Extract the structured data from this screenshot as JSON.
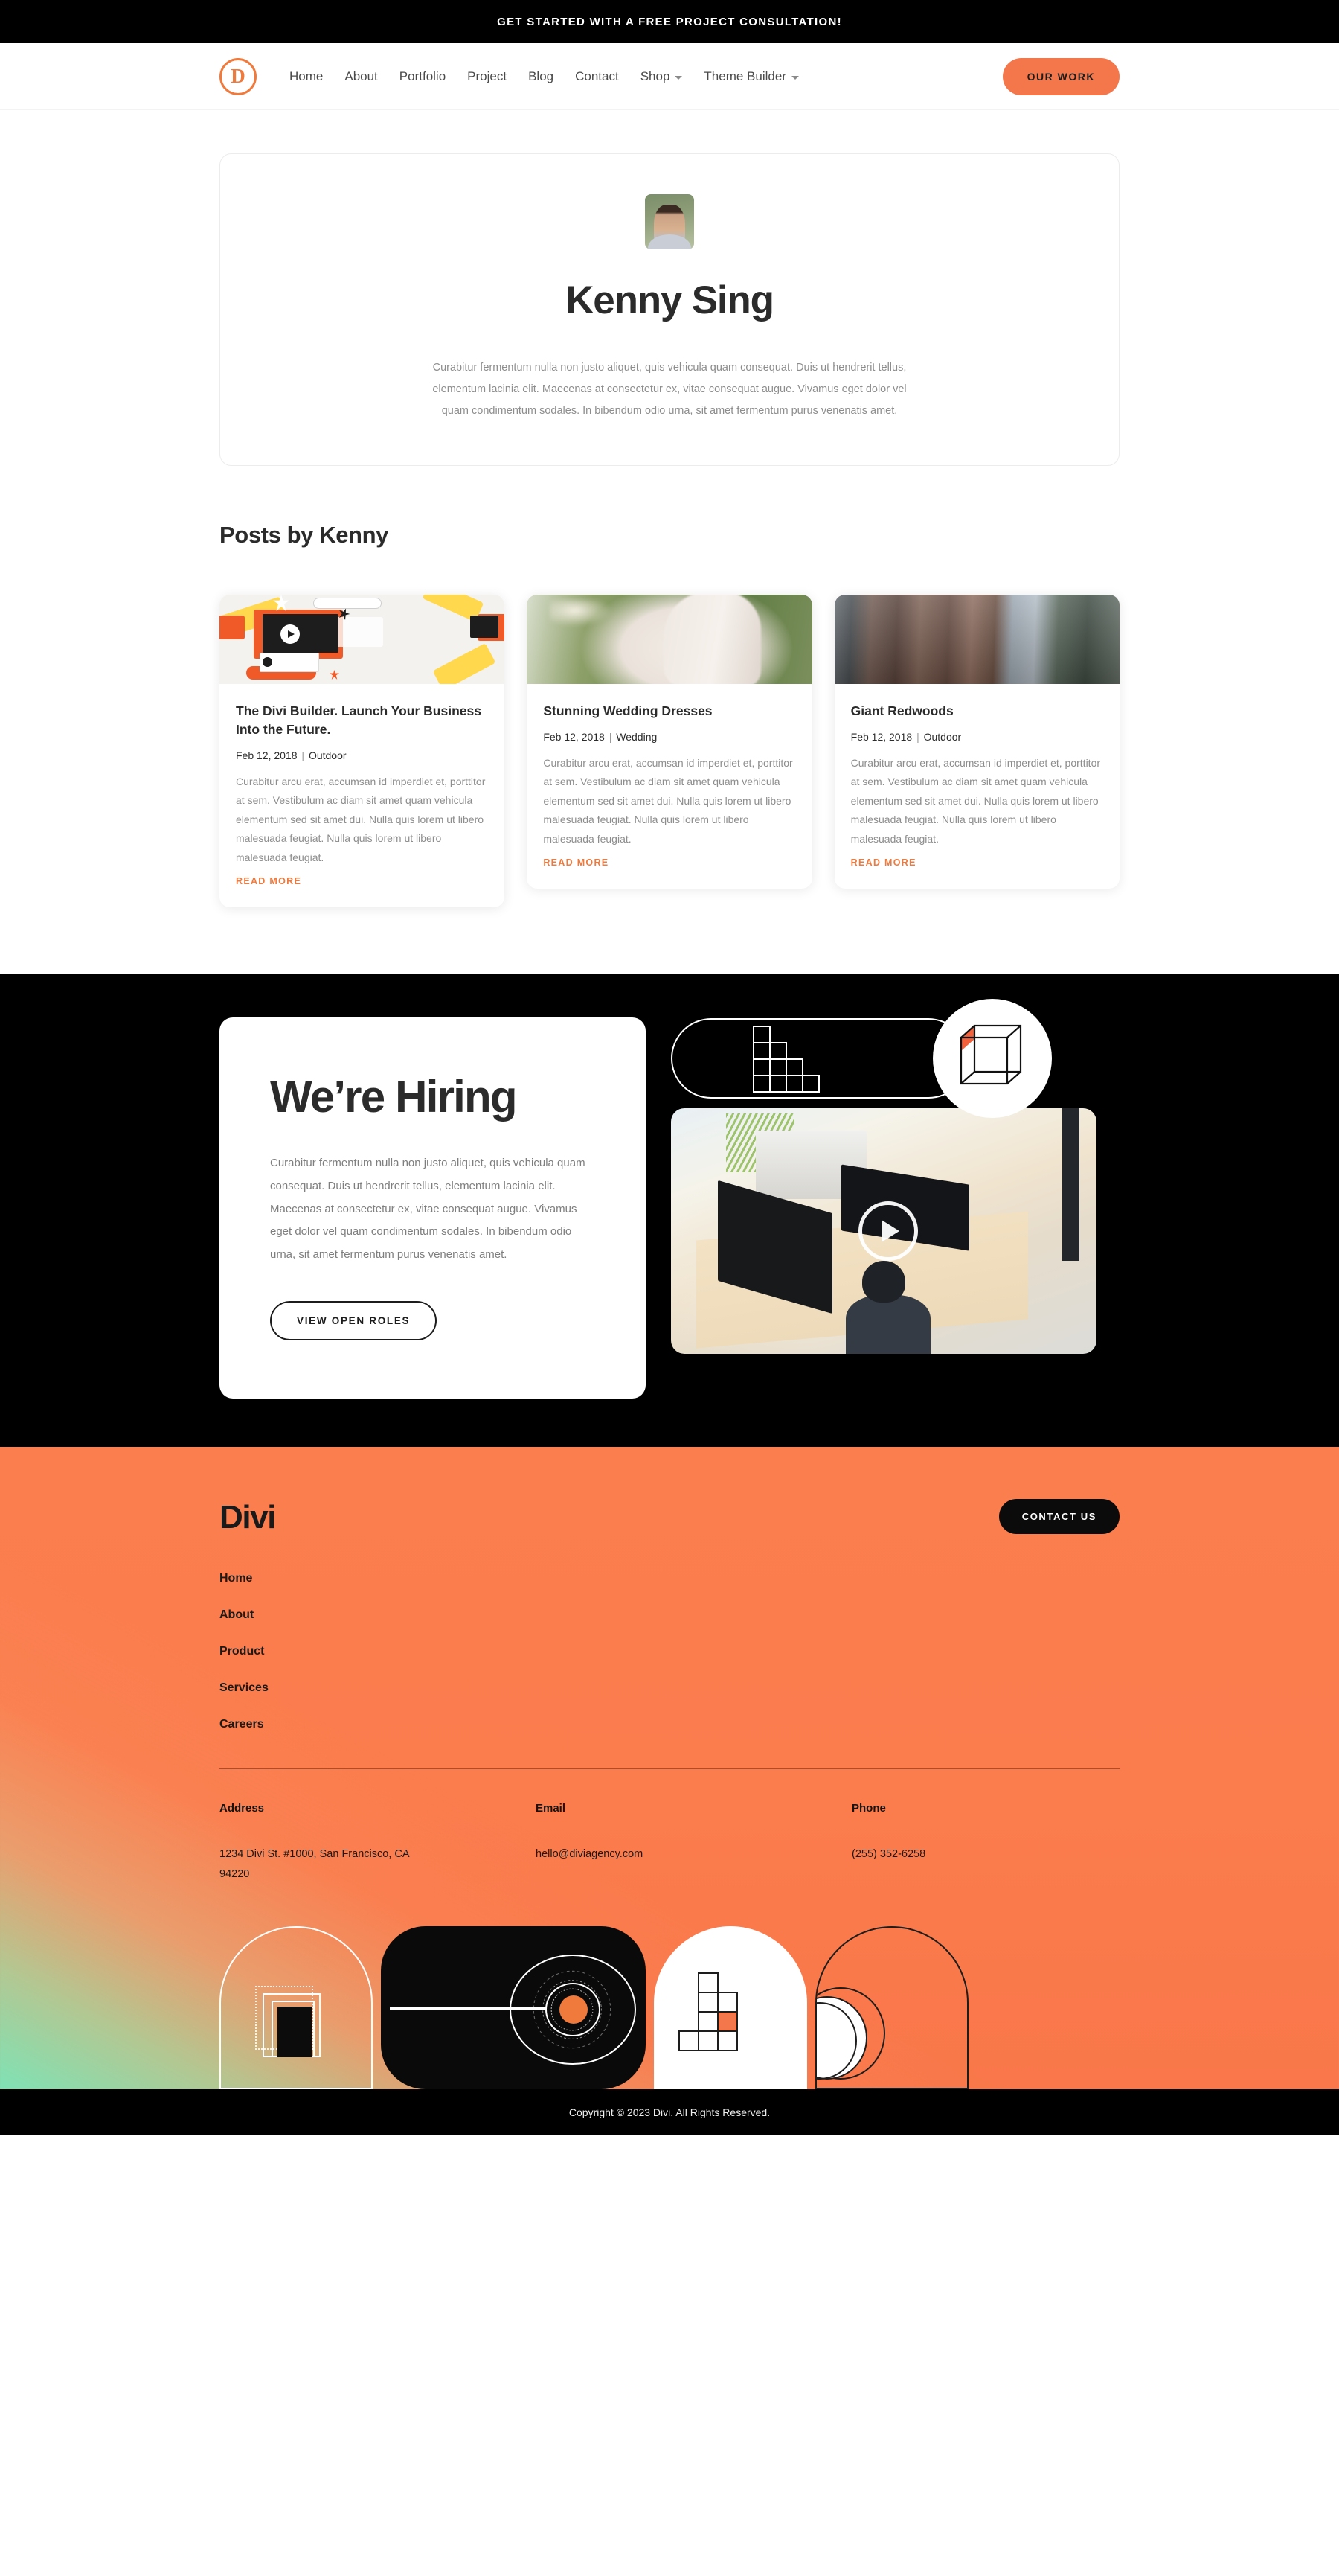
{
  "announcement": {
    "text": "GET STARTED WITH A FREE PROJECT CONSULTATION!"
  },
  "header": {
    "logo_letter": "D",
    "nav": [
      {
        "label": "Home",
        "has_caret": false
      },
      {
        "label": "About",
        "has_caret": false
      },
      {
        "label": "Portfolio",
        "has_caret": false
      },
      {
        "label": "Project",
        "has_caret": false
      },
      {
        "label": "Blog",
        "has_caret": false
      },
      {
        "label": "Contact",
        "has_caret": false
      },
      {
        "label": "Shop",
        "has_caret": true
      },
      {
        "label": "Theme Builder",
        "has_caret": true
      }
    ],
    "cta_label": "OUR WORK"
  },
  "author": {
    "name": "Kenny Sing",
    "bio": "Curabitur fermentum nulla non justo aliquet, quis vehicula quam consequat. Duis ut hendrerit tellus, elementum lacinia elit. Maecenas at consectetur ex, vitae consequat augue. Vivamus eget dolor vel quam condimentum sodales. In bibendum odio urna, sit amet fermentum purus venenatis amet."
  },
  "posts_section": {
    "title": "Posts by Kenny",
    "read_more_label": "READ MORE",
    "posts": [
      {
        "title": "The Divi Builder. Launch Your Business Into the Future.",
        "date": "Feb 12, 2018",
        "category": "Outdoor",
        "excerpt": "Curabitur arcu erat, accumsan id imperdiet et, porttitor at sem. Vestibulum ac diam sit amet quam vehicula elementum sed sit amet dui. Nulla quis lorem ut libero malesuada feugiat. Nulla quis lorem ut libero malesuada feugiat.",
        "thumb": "divi-builder-illustration"
      },
      {
        "title": "Stunning Wedding Dresses",
        "date": "Feb 12, 2018",
        "category": "Wedding",
        "excerpt": "Curabitur arcu erat, accumsan id imperdiet et, porttitor at sem. Vestibulum ac diam sit amet quam vehicula elementum sed sit amet dui. Nulla quis lorem ut libero malesuada feugiat. Nulla quis lorem ut libero malesuada feugiat.",
        "thumb": "wedding-dress-photo"
      },
      {
        "title": "Giant Redwoods",
        "date": "Feb 12, 2018",
        "category": "Outdoor",
        "excerpt": "Curabitur arcu erat, accumsan id imperdiet et, porttitor at sem. Vestibulum ac diam sit amet quam vehicula elementum sed sit amet dui. Nulla quis lorem ut libero malesuada feugiat. Nulla quis lorem ut libero malesuada feugiat.",
        "thumb": "redwood-trees-photo"
      }
    ]
  },
  "hiring": {
    "title": "We’re Hiring",
    "text": "Curabitur fermentum nulla non justo aliquet, quis vehicula quam consequat. Duis ut hendrerit tellus, elementum lacinia elit. Maecenas at consectetur ex, vitae consequat augue. Vivamus eget dolor vel quam condimentum sodales. In bibendum odio urna, sit amet fermentum purus venenatis amet.",
    "cta_label": "VIEW OPEN ROLES",
    "decorations": [
      "stair-grid-icon",
      "wireframe-cube-icon",
      "office-video-thumbnail"
    ]
  },
  "footer": {
    "logo": "Divi",
    "cta_label": "CONTACT US",
    "nav": [
      {
        "label": "Home"
      },
      {
        "label": "About"
      },
      {
        "label": "Product"
      },
      {
        "label": "Services"
      },
      {
        "label": "Careers"
      }
    ],
    "info": [
      {
        "label": "Address",
        "value": "1234 Divi St. #1000, San Francisco, CA 94220"
      },
      {
        "label": "Email",
        "value": "hello@diviagency.com"
      },
      {
        "label": "Phone",
        "value": "(255) 352-6258"
      }
    ],
    "decorations": [
      "nested-squares-arch-icon",
      "radial-target-arch-icon",
      "stair-grid-arch-icon",
      "nested-ovals-arch-icon"
    ]
  },
  "copyright": {
    "text": "Copyright © 2023 Divi. All Rights Reserved."
  },
  "colors": {
    "accent_orange": "#f4764b",
    "footer_orange": "#fb7e4f",
    "dark": "#000000",
    "text_dark": "#2b2b2b",
    "text_muted": "#8d8d8d",
    "read_more": "#f0793c",
    "mint_gradient": "#78e8bb"
  }
}
